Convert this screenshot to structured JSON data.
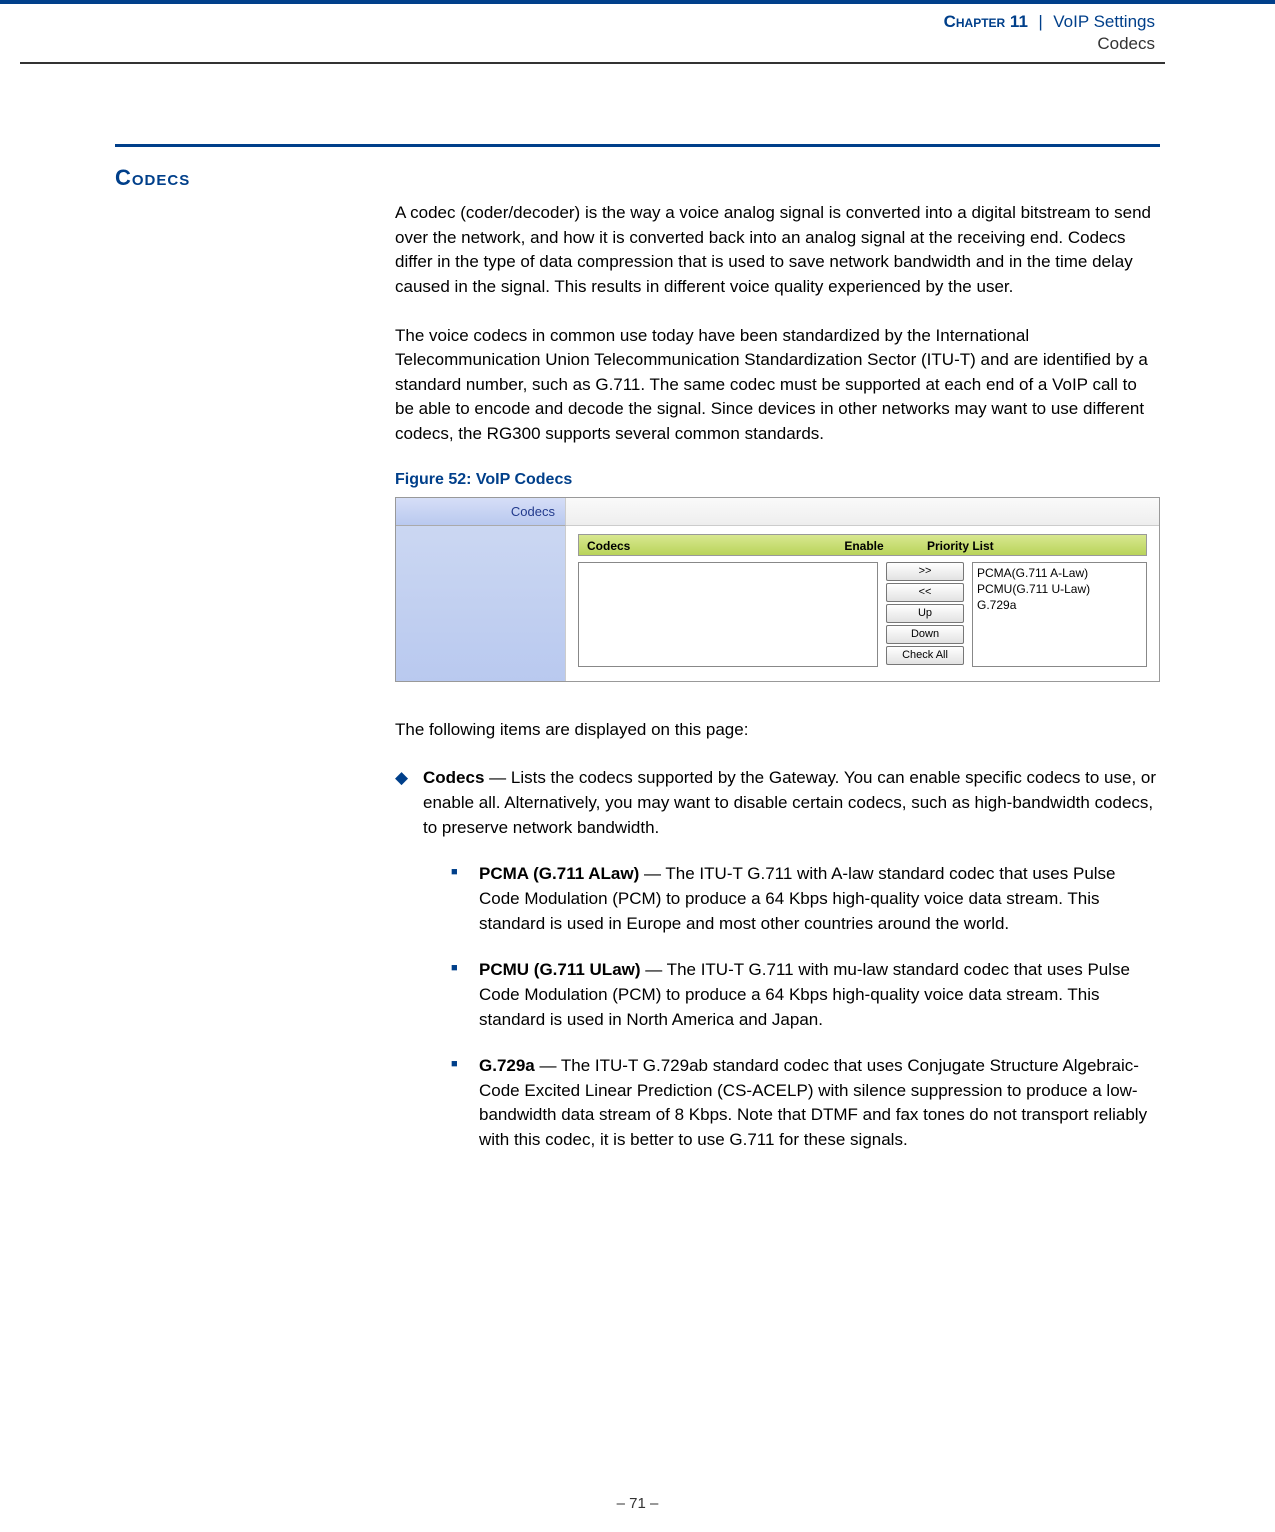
{
  "header": {
    "chapter_label": "Chapter 11",
    "separator": "|",
    "title": "VoIP Settings",
    "subtitle": "Codecs"
  },
  "section_heading": "Codecs",
  "paragraphs": {
    "p1": "A codec (coder/decoder) is the way a voice analog signal is converted into a digital bitstream to send over the network, and how it is converted back into an analog signal at the receiving end. Codecs differ in the type of data compression that is used to save network bandwidth and in the time delay caused in the signal. This results in different voice quality experienced by the user.",
    "p2": "The voice codecs in common use today have been standardized by the International Telecommunication Union Telecommunication Standardization Sector (ITU-T) and are identified by a standard number, such as G.711. The same codec must be supported at each end of a VoIP call to be able to encode and decode the signal. Since devices in other networks may want to use different codecs, the RG300 supports several common standards."
  },
  "figure": {
    "caption": "Figure 52:  VoIP Codecs",
    "sidebar_label": "Codecs",
    "headers": {
      "codecs": "Codecs",
      "enable": "Enable",
      "priority": "Priority List"
    },
    "buttons": {
      "right": ">>",
      "left": "<<",
      "up": "Up",
      "down": "Down",
      "checkall": "Check All"
    },
    "priority_items": [
      "PCMA(G.711 A-Law)",
      "PCMU(G.711 U-Law)",
      "G.729a"
    ]
  },
  "intro_line": "The following items are displayed on this page:",
  "items": {
    "codecs": {
      "label": "Codecs",
      "text": " — Lists the codecs supported by the Gateway. You can enable specific codecs to use, or enable all. Alternatively, you may want to disable certain codecs, such as high-bandwidth codecs, to preserve network bandwidth."
    },
    "pcma": {
      "label": "PCMA (G.711 ALaw)",
      "text": " — The ITU-T G.711 with A-law standard codec that uses Pulse Code Modulation (PCM) to produce a 64 Kbps high-quality voice data stream. This standard is used in Europe and most other countries around the world."
    },
    "pcmu": {
      "label": "PCMU (G.711 ULaw)",
      "text": " — The ITU-T G.711 with mu-law standard codec that uses Pulse Code Modulation (PCM) to produce a 64 Kbps high-quality voice data stream. This standard is used in North America and Japan."
    },
    "g729a": {
      "label": "G.729a",
      "text": " — The ITU-T G.729ab standard codec that uses Conjugate Structure Algebraic-Code Excited Linear Prediction (CS-ACELP) with silence suppression to produce a low-bandwidth data stream of 8 Kbps. Note that DTMF and fax tones do not transport reliably with this codec, it is better to use G.711 for these signals."
    }
  },
  "footer": "–  71  –"
}
